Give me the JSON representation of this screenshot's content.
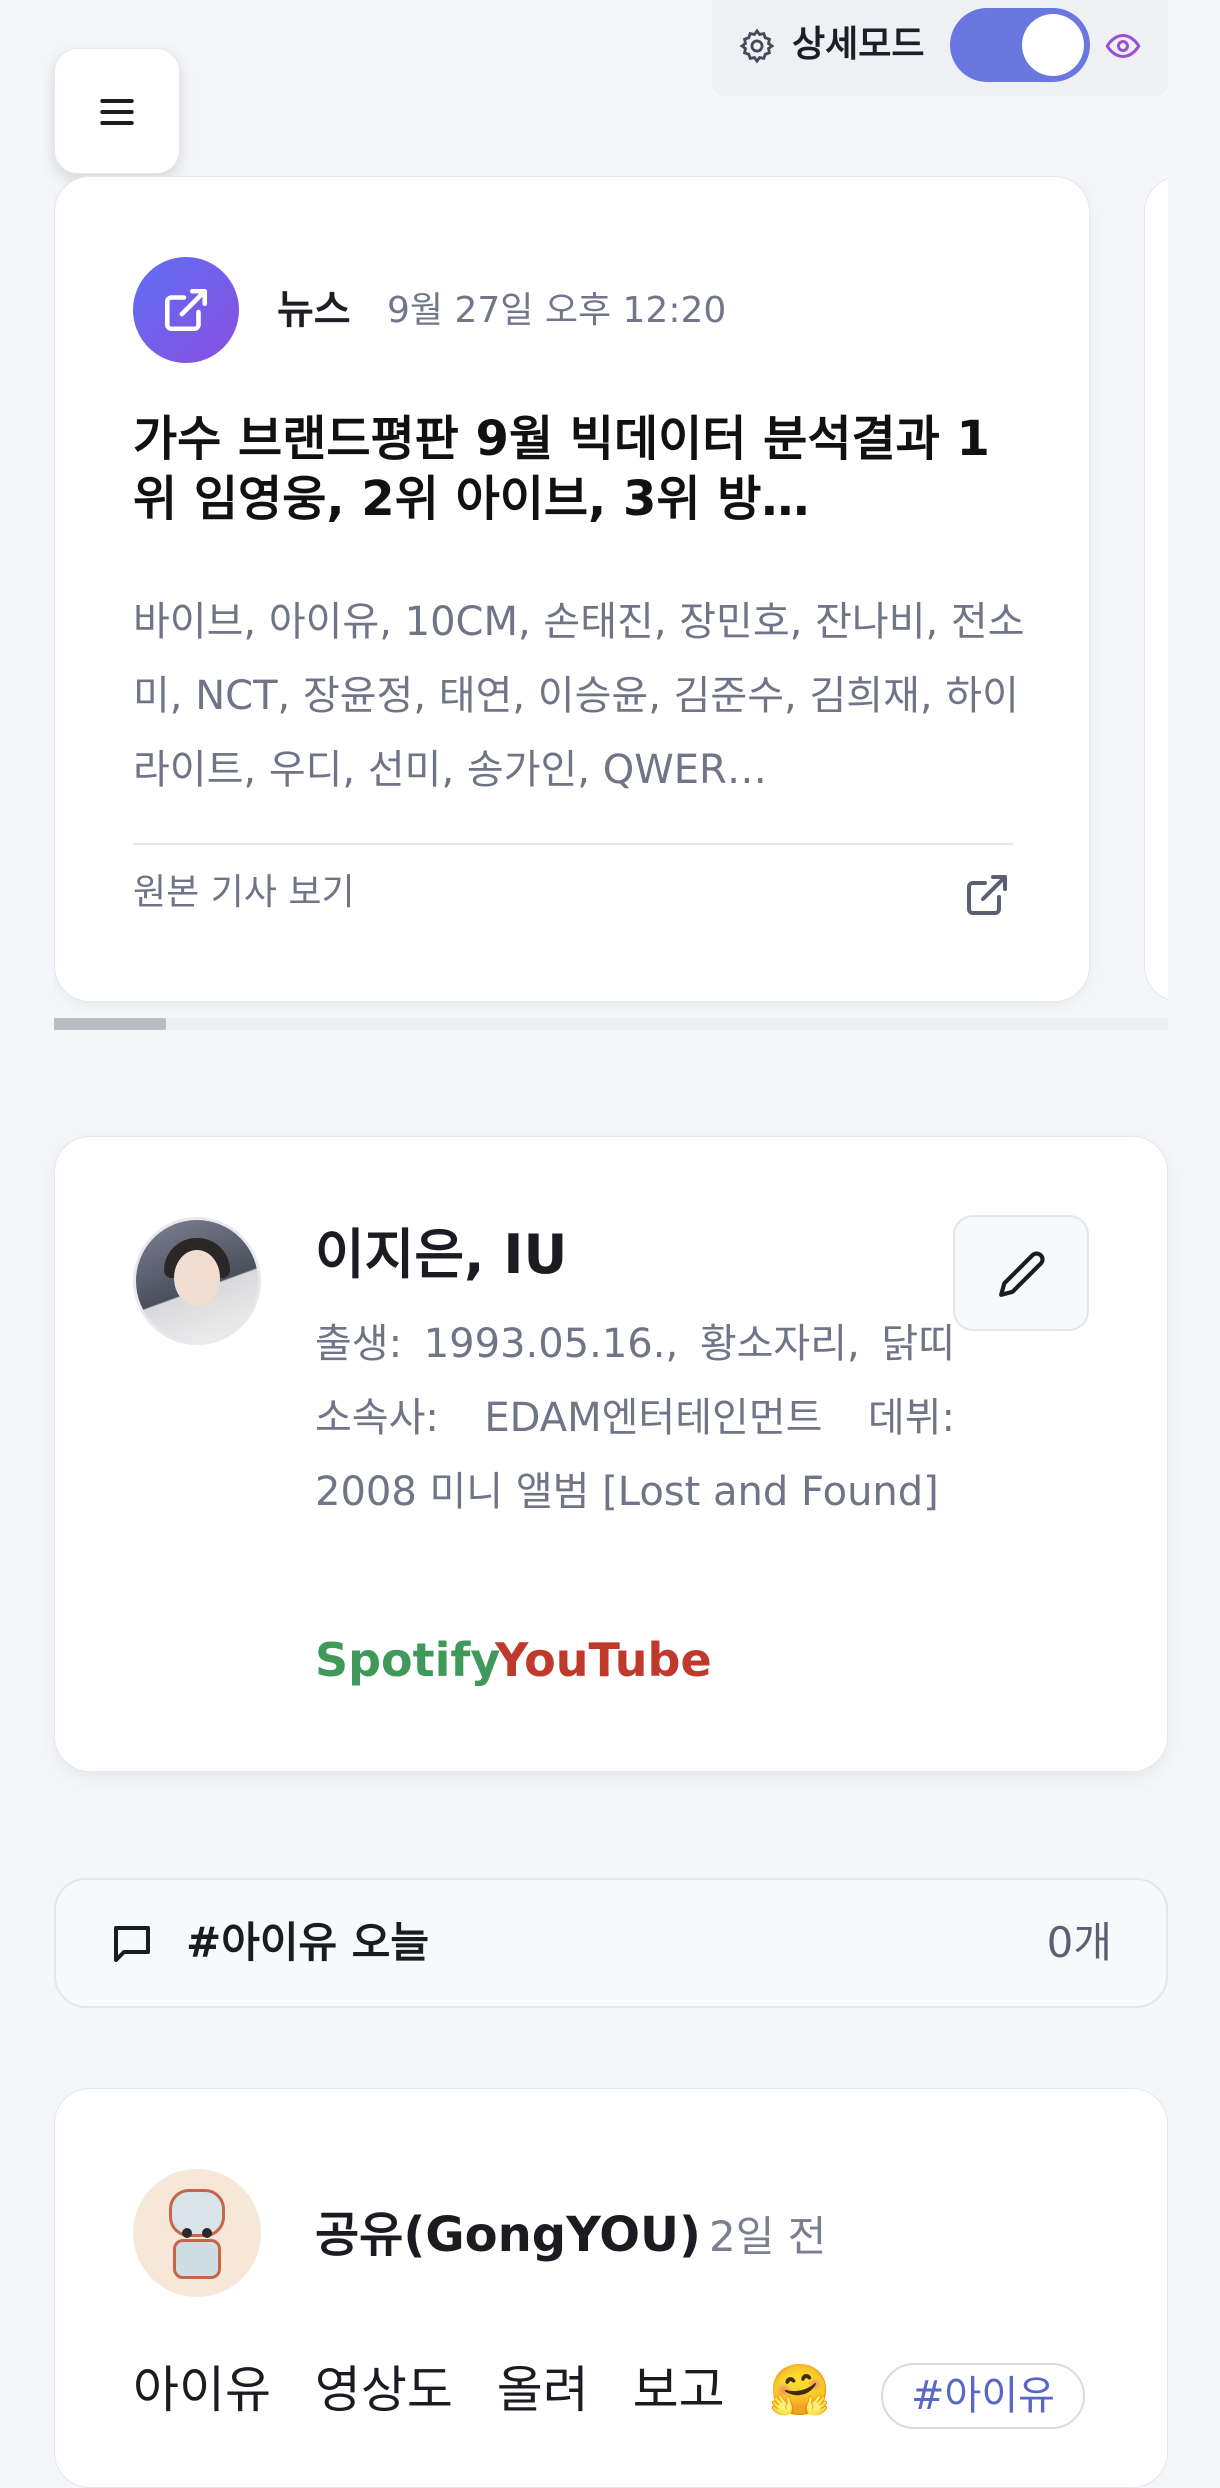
{
  "header": {
    "mode_label": "상세모드",
    "toggle_on": true
  },
  "news": {
    "source": "뉴스",
    "time": "9월 27일 오후 12:20",
    "title": "가수 브랜드평판 9월 빅데이터 분석결과 1위 임영웅, 2위 아이브, 3위 방…",
    "body": "바이브, 아이유, 10CM, 손태진, 장민호, 잔나비, 전소미, NCT, 장윤정, 태연, 이승윤, 김준수, 김희재, 하이라이트, 우디, 선미, 송가인, QWER…",
    "link_label": "원본 기사 보기"
  },
  "profile": {
    "name": "이지은, IU",
    "description": "출생: 1993.05.16., 황소자리, 닭띠 소속사: EDAM엔터테인먼트 데뷔: 2008 미니 앨범 [Lost and Found]",
    "spotify": "Spotify",
    "youtube": "YouTube"
  },
  "tag_bar": {
    "label": "#아이유 오늘",
    "count": "0개"
  },
  "post": {
    "author": "공유(GongYOU)",
    "time": "2일 전",
    "text": "아이유 영상도 올려 보고 🤗",
    "tag": "#아이유"
  },
  "colors": {
    "accent": "#6a77e0",
    "spotify": "#3f9a59",
    "youtube": "#c0392b",
    "eye": "#9b4fd6"
  }
}
